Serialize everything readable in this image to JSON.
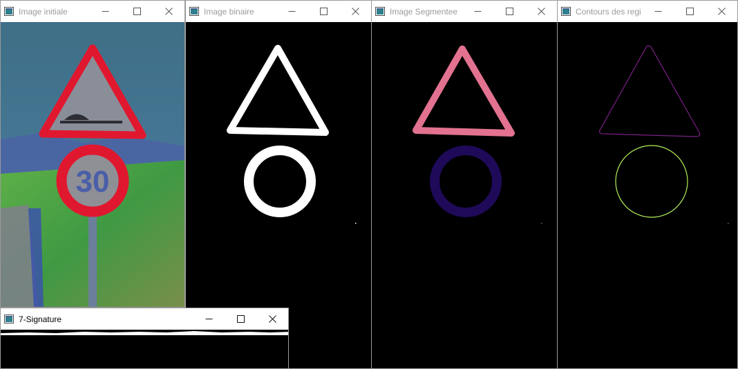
{
  "windows": [
    {
      "title": "Image initiale",
      "active": false
    },
    {
      "title": "Image binaire",
      "active": false
    },
    {
      "title": "Image Segmentee",
      "active": false
    },
    {
      "title": "Contours des regi...",
      "active": false
    },
    {
      "title": "7-Signature",
      "active": true
    }
  ],
  "icons": {
    "app": "opencv-window-icon",
    "minimize": "minimize-icon",
    "maximize": "maximize-icon",
    "close": "close-icon"
  },
  "colors": {
    "sign_red": "#e0182f",
    "segment_pink": "#e27290",
    "segment_navy": "#1f0a5a",
    "contour_purple": "#7b1f86",
    "contour_lime": "#b6f05a"
  },
  "scene": {
    "sign_speed_limit": "30"
  }
}
